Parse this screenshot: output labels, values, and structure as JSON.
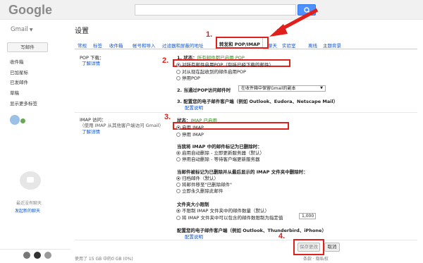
{
  "header": {
    "logo": "Google",
    "search_placeholder": ""
  },
  "app_switch": "Gmail",
  "page_title": "设置",
  "sidebar": {
    "compose": "写邮件",
    "items": [
      "收件箱",
      "已加星标",
      "已发邮件",
      "草稿",
      "显示更多标签"
    ],
    "chat": {
      "none": "最近没有聊天",
      "start": "发起新的聊天"
    }
  },
  "tabs": [
    "常规",
    "标签",
    "收件箱",
    "帐号和导入",
    "过滤器和屏蔽的地址",
    "转发和 POP/IMAP",
    "聊天",
    "实验室",
    "离线",
    "主题背景"
  ],
  "pop": {
    "title": "POP 下载：",
    "learn": "了解详情",
    "status_prefix": "1. 状态：",
    "status_text": "所有邮件都已启用 POP",
    "opt1": "对所有邮件启用POP（包括已经下载的邮件）",
    "opt2": "对从现在起收到的邮件启用POP",
    "opt3": "停用POP",
    "q2": "2. 当通过POP访问邮件时",
    "q2_select": "在收件箱中保留Gmail的副本",
    "q3": "3. 配置您的电子邮件客户端（例如 Outlook、Eudora、Netscape Mail）",
    "q3_link": "配置说明"
  },
  "imap": {
    "title": "IMAP 访问：",
    "subtitle": "（使用 IMAP 从其他客户端访问 Gmail）",
    "learn": "了解详情",
    "status_prefix": "状态：",
    "status_text": "IMAP 已启用",
    "opt_on": "启用 IMAP",
    "opt_off": "停用 IMAP",
    "g1_title": "当我将 IMAP 中的邮件标记为已删除时：",
    "g1_a": "启用自动删除 - 立即更新服务器（默认）",
    "g1_b": "停用自动删除 - 等待客户端更新服务器",
    "g2_title": "当邮件被标记为已删除并从最后显示的 IMAP 文件夹中删除时：",
    "g2_a": "归档邮件（默认）",
    "g2_b": "将邮件移至\"已删除邮件\"",
    "g2_c": "立即永久删除此邮件",
    "g3_title": "文件夹大小限制",
    "g3_a": "不限制 IMAP 文件夹中的邮件数量（默认）",
    "g3_b": "将 IMAP 文件夹中可以包含的邮件数限制为指定值",
    "g3_select": "1,000",
    "cfg": "配置您的电子邮件客户端（例如 Outlook、Thunderbird、iPhone）",
    "cfg_link": "配置说明"
  },
  "buttons": {
    "save": "保存更改",
    "cancel": "取消"
  },
  "annotations": [
    "1.",
    "2.",
    "3.",
    "4."
  ],
  "footer": {
    "left": "使用了 15 GB 中的0 GB (0%)",
    "right": "条款 · 隐私权"
  }
}
